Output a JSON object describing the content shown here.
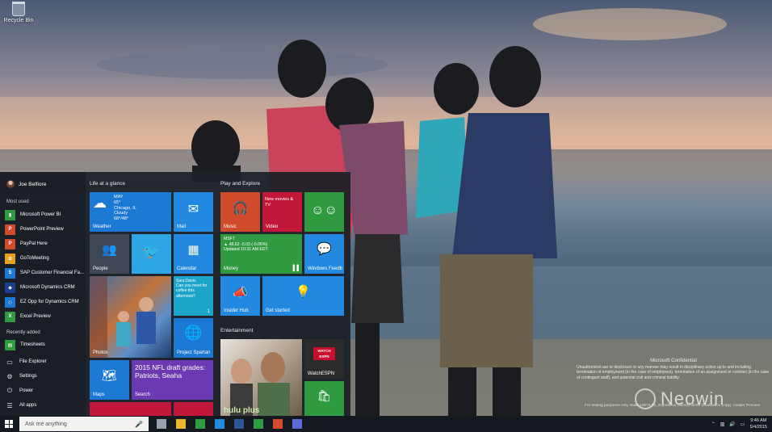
{
  "desktop": {
    "recycle_bin_label": "Recycle Bin",
    "confidential_title": "Microsoft Confidential",
    "confidential_text": "Unauthorized use or disclosure in any manner may result in disciplinary action up to and including termination of employment (in the case of employees), termination of an assignment or contract (in the case of contingent staff), and potential civil and criminal liability.",
    "build_text": "For testing purposes only. Build 10074.fbl_impressive.150424-2000 (Evaluation copy). Insider Preview",
    "watermark": "Neowin"
  },
  "start_menu": {
    "user_name": "Joe Belfiore",
    "most_used_label": "Most used",
    "most_used": [
      {
        "name": "Microsoft Power BI",
        "icon": "power-bi-icon",
        "color": "#2f9a40",
        "glyph": "▮"
      },
      {
        "name": "PowerPoint Preview",
        "icon": "powerpoint-icon",
        "color": "#d04a2c",
        "glyph": "P"
      },
      {
        "name": "PayPal Here",
        "icon": "paypal-icon",
        "color": "#d04a2c",
        "glyph": "P"
      },
      {
        "name": "GoToMeeting",
        "icon": "gotomeeting-icon",
        "color": "#e6a21b",
        "glyph": "✿"
      },
      {
        "name": "SAP Customer Financial Fa...",
        "icon": "sap-icon",
        "color": "#1b78d3",
        "glyph": "S"
      },
      {
        "name": "Microsoft Dynamics CRM",
        "icon": "dynamics-crm-icon",
        "color": "#1b3f8f",
        "glyph": "◆"
      },
      {
        "name": "EZ Opp for Dynamics CRM",
        "icon": "ez-opp-icon",
        "color": "#1b78d3",
        "glyph": "◇"
      },
      {
        "name": "Excel Preview",
        "icon": "excel-icon",
        "color": "#2f9a40",
        "glyph": "X"
      }
    ],
    "recently_added_label": "Recently added",
    "recently_added": [
      {
        "name": "Timesheets",
        "icon": "timesheets-icon",
        "color": "#2f9a40",
        "glyph": "▤"
      }
    ],
    "system": [
      {
        "name": "File Explorer",
        "icon": "file-explorer-icon",
        "glyph": "▭"
      },
      {
        "name": "Settings",
        "icon": "gear-icon",
        "glyph": "⚙"
      },
      {
        "name": "Power",
        "icon": "power-icon",
        "glyph": "⏻"
      },
      {
        "name": "All apps",
        "icon": "all-apps-icon",
        "glyph": "☰"
      }
    ],
    "groups": {
      "life": "Life at a glance",
      "play": "Play and Explore",
      "entertainment": "Entertainment"
    },
    "tiles": {
      "weather": {
        "name": "Weather",
        "day": "MAY",
        "temp": "65°",
        "city": "Chicago, IL",
        "condition": "Cloudy",
        "range": "68°/48°"
      },
      "mail": {
        "name": "Mail"
      },
      "people": {
        "name": "People"
      },
      "twitter": {
        "name": "Twitter"
      },
      "calendar": {
        "name": "Calendar"
      },
      "photos": {
        "name": "Photos"
      },
      "message": {
        "sender": "Sara Davis",
        "text": "Can you meet for coffee this afternoon?",
        "count": "1"
      },
      "project_spartan": {
        "name": "Project Spartan"
      },
      "maps": {
        "name": "Maps"
      },
      "search": {
        "headline": "2015 NFL draft grades: Patriots, Seaha",
        "name": "Search"
      },
      "music": {
        "name": "Music"
      },
      "video": {
        "headline": "New movies & TV",
        "name": "Video"
      },
      "xbox": {
        "name": "Xbox"
      },
      "money": {
        "ticker": "MSFT",
        "change": "▲ 48.62   -0.03 (-0.06%)",
        "updated": "Updated   10:31 AM EDT",
        "name": "Money"
      },
      "windows_feedback": {
        "name": "Windows Feedb"
      },
      "insider_hub": {
        "name": "Insider Hub"
      },
      "get_started": {
        "name": "Get started"
      },
      "hulu": {
        "brand": "hulu plus"
      },
      "watchespn": {
        "badge_top": "WATCH",
        "badge_bottom": "ESPN",
        "name": "WatchESPN"
      },
      "store": {
        "name": "Store"
      }
    }
  },
  "taskbar": {
    "search_placeholder": "Ask me anything",
    "time": "9:46 AM",
    "date": "5/4/2015",
    "pinned": [
      {
        "icon": "task-view-icon",
        "color": "#9aa3ad"
      },
      {
        "icon": "file-explorer-icon",
        "color": "#e8b72f"
      },
      {
        "icon": "store-icon",
        "color": "#2f9a40"
      },
      {
        "icon": "ie-icon",
        "color": "#2288e0"
      },
      {
        "icon": "word-icon",
        "color": "#2b5797"
      },
      {
        "icon": "excel-icon",
        "color": "#2f9a40"
      },
      {
        "icon": "powerpoint-icon",
        "color": "#d04a2c"
      },
      {
        "icon": "app-icon",
        "color": "#5a6bd8"
      }
    ]
  }
}
